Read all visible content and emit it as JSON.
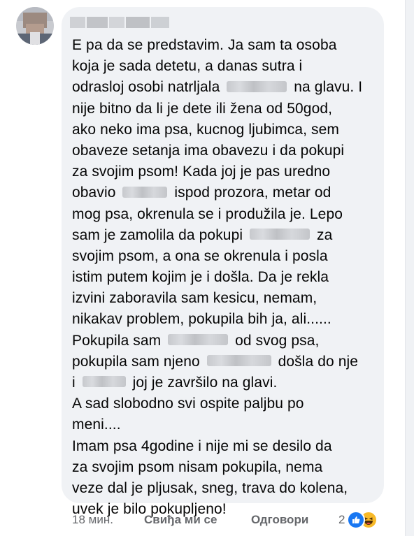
{
  "comment": {
    "author_name": "",
    "lines": [
      [
        {
          "t": "E pa da se predstavim. Ja sam ta osoba"
        }
      ],
      [
        {
          "t": "koja je sada detetu, a danas sutra i"
        }
      ],
      [
        {
          "t": "odrasloj osobi natrljala "
        },
        {
          "blur": 86
        },
        {
          "t": " na glavu. I"
        }
      ],
      [
        {
          "t": "nije bitno da li je dete ili žena od 50god,"
        }
      ],
      [
        {
          "t": "ako neko ima psa, kucnog ljubimca, sem"
        }
      ],
      [
        {
          "t": "obaveze setanja ima obavezu i da pokupi"
        }
      ],
      [
        {
          "t": "za svojim psom! Kada joj je pas uredno"
        }
      ],
      [
        {
          "t": "obavio "
        },
        {
          "blur": 64
        },
        {
          "t": " ispod prozora, metar od"
        }
      ],
      [
        {
          "t": "mog psa, okrenula se i produžila je. Lepo"
        }
      ],
      [
        {
          "t": "sam je zamolila da pokupi "
        },
        {
          "blur": 86
        },
        {
          "t": " za"
        }
      ],
      [
        {
          "t": "svojim psom, a ona se okrenula i posla"
        }
      ],
      [
        {
          "t": "istim putem kojim je i došla. Da je rekla"
        }
      ],
      [
        {
          "t": "izvini zaboravila sam kesicu, nemam,"
        }
      ],
      [
        {
          "t": "nikakav problem, pokupila bih ja, ali......"
        }
      ],
      [
        {
          "t": "Pokupila sam "
        },
        {
          "blur": 86
        },
        {
          "t": " od svog psa,"
        }
      ],
      [
        {
          "t": "pokupila sam njeno "
        },
        {
          "blur": 92
        },
        {
          "t": " došla do nje"
        }
      ],
      [
        {
          "t": "i "
        },
        {
          "blur": 62
        },
        {
          "t": " joj je završilo na glavi."
        }
      ],
      [
        {
          "t": "A sad slobodno svi ospite paljbu po"
        }
      ],
      [
        {
          "t": "meni...."
        }
      ],
      [
        {
          "t": "Imam psa 4godine i nije mi se desilo da"
        }
      ],
      [
        {
          "t": "za svojim psom nisam pokupila, nema"
        }
      ],
      [
        {
          "t": "veze dal je pljusak, sneg, trava do kolena,"
        }
      ],
      [
        {
          "t": "uvek je bilo pokupljeno!"
        }
      ]
    ]
  },
  "actions": {
    "time": "18 мин.",
    "like_label": "Свиђа ми се",
    "reply_label": "Одговори",
    "reaction_count": "2",
    "reaction_icons": [
      "like-reaction-icon",
      "haha-reaction-icon"
    ]
  },
  "colors": {
    "bubble": "#f0f2f5",
    "text": "#050505",
    "meta": "#65676b",
    "like_blue": "#1877f2",
    "haha_yellow": "#f7b928"
  }
}
